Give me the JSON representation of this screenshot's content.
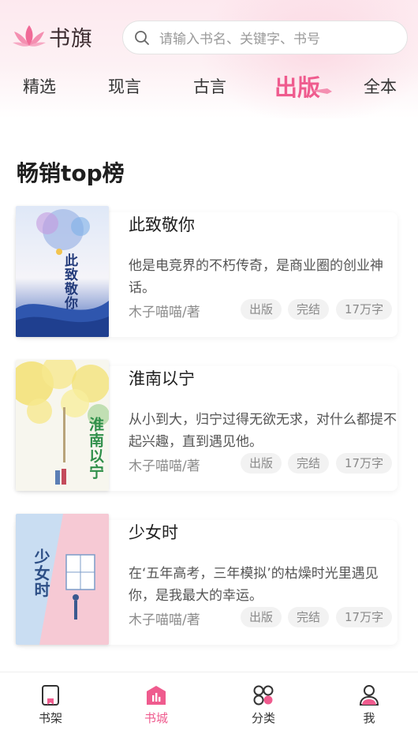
{
  "header": {
    "logo_text": "书旗",
    "search_placeholder": "请输入书名、关键字、书号",
    "tabs": [
      {
        "label": "精选"
      },
      {
        "label": "现言"
      },
      {
        "label": "古言"
      },
      {
        "label": "出版"
      },
      {
        "label": "全本"
      }
    ],
    "active_tab": "出版"
  },
  "section": {
    "title": "畅销top榜"
  },
  "books": [
    {
      "title": "此致敬你",
      "cover_text": "此致敬你",
      "description": "他是电竞界的不朽传奇，是商业圈的创业神话。",
      "author": "木子喵喵/著",
      "tags": [
        "出版",
        "完结",
        "17万字"
      ]
    },
    {
      "title": "淮南以宁",
      "cover_text": "淮南以宁",
      "description": "从小到大，归宁过得无欲无求，对什么都提不起兴趣，直到遇见他。",
      "author": "木子喵喵/著",
      "tags": [
        "出版",
        "完结",
        "17万字"
      ]
    },
    {
      "title": "少女时",
      "cover_text": "少女时",
      "description": "在‘五年高考，三年模拟’的枯燥时光里遇见你，是我最大的幸运。",
      "author": "木子喵喵/著",
      "tags": [
        "出版",
        "完结",
        "17万字"
      ]
    }
  ],
  "bottom_nav": {
    "items": [
      {
        "label": "书架",
        "icon": "bookshelf-icon"
      },
      {
        "label": "书城",
        "icon": "bookstore-icon"
      },
      {
        "label": "分类",
        "icon": "category-icon"
      },
      {
        "label": "我",
        "icon": "profile-icon"
      }
    ],
    "active": "书城"
  },
  "colors": {
    "accent": "#ef5b8e",
    "header_bg": "#fde9ef",
    "tag_bg": "#f2f2f2"
  }
}
